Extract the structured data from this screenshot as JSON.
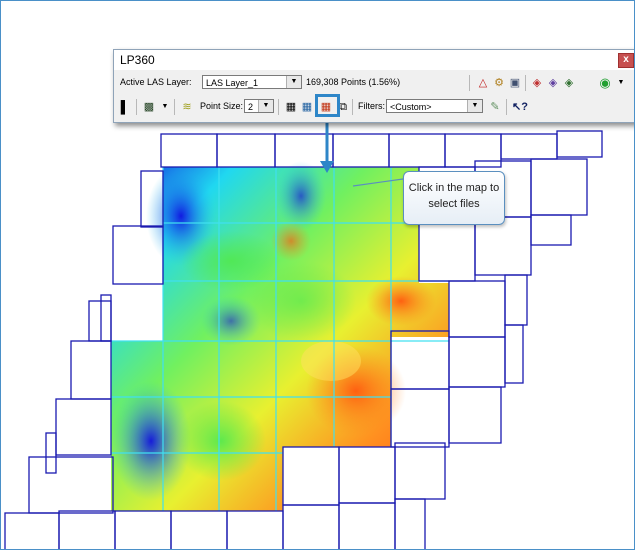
{
  "window": {
    "title": "LP360",
    "close_glyph": "x"
  },
  "toolbar": {
    "active_layer_label": "Active LAS Layer:",
    "active_layer_value": "LAS Layer_1",
    "points_text": "169,308 Points (1.56%)",
    "point_size_label": "Point Size:",
    "point_size_value": "2",
    "filters_label": "Filters:",
    "filters_value": "<Custom>",
    "icons": [
      "bar-icon",
      "layer-icon",
      "dropdown-icon",
      "profile-icon",
      "grid-icon",
      "tiles-icon",
      "select-files-icon",
      "copy-icon",
      "warning-triangle-icon",
      "properties-icon",
      "settings-icon",
      "layers-icon",
      "filter-icon",
      "whats-this-icon"
    ]
  },
  "callout": {
    "text": "Click in the map to select files"
  },
  "colors": {
    "accent": "#2e86c8",
    "tile_outline": "#1a1ab0",
    "selected_outline": "#40e0f0"
  }
}
